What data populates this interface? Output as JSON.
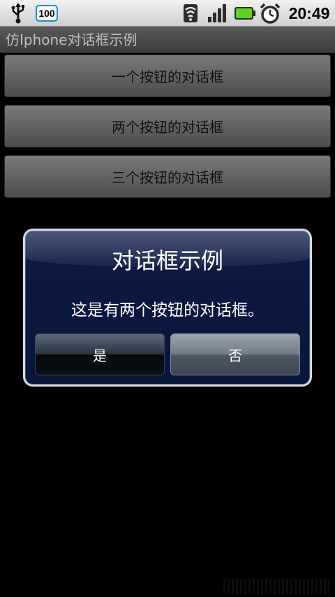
{
  "status_bar": {
    "usb_icon": "usb-icon",
    "battery_badge": "100",
    "wifi_icon": "wifi-icon",
    "signal_icon": "signal-icon",
    "battery_icon": "battery-icon",
    "alarm_icon": "alarm-clock-icon",
    "time": "20:49"
  },
  "title_bar": {
    "title": "仿Iphone对话框示例"
  },
  "buttons": {
    "one": "一个按钮的对话框",
    "two": "两个按钮的对话框",
    "three": "三个按钮的对话框"
  },
  "dialog": {
    "title": "对话框示例",
    "message": "这是有两个按钮的对话框。",
    "yes_label": "是",
    "no_label": "否"
  },
  "colors": {
    "battery_green": "#5fd11f",
    "dialog_background": "#0c1a43",
    "battery_badge_border": "#1592c7"
  }
}
